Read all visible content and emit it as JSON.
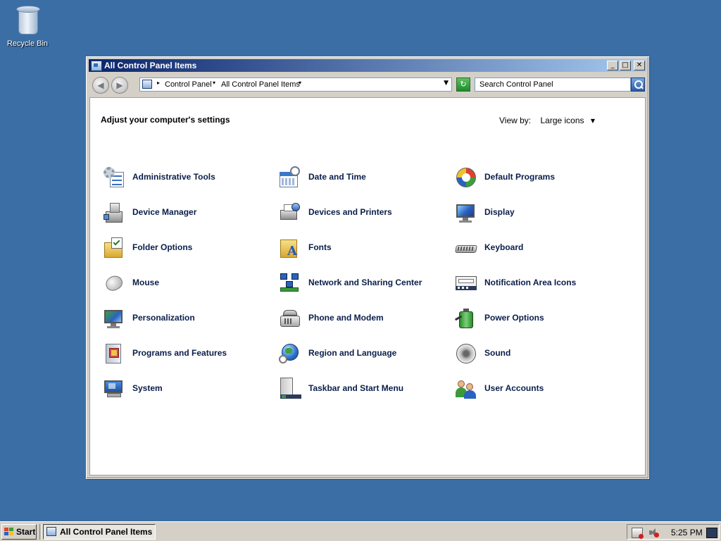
{
  "desktop": {
    "recycle_bin_label": "Recycle Bin"
  },
  "window": {
    "title": "All Control Panel Items",
    "controls": {
      "minimize": "_",
      "maximize": "□",
      "close": "✕"
    }
  },
  "address": {
    "breadcrumb": [
      "Control Panel",
      "All Control Panel Items"
    ],
    "search_placeholder": "Search Control Panel"
  },
  "content": {
    "heading": "Adjust your computer's settings",
    "view_by_label": "View by:",
    "view_by_value": "Large icons"
  },
  "items": [
    {
      "label": "Administrative Tools",
      "icon": "administrative-tools-icon"
    },
    {
      "label": "Date and Time",
      "icon": "date-time-icon"
    },
    {
      "label": "Default Programs",
      "icon": "default-programs-icon"
    },
    {
      "label": "Device Manager",
      "icon": "device-manager-icon"
    },
    {
      "label": "Devices and Printers",
      "icon": "devices-printers-icon"
    },
    {
      "label": "Display",
      "icon": "display-icon"
    },
    {
      "label": "Folder Options",
      "icon": "folder-options-icon"
    },
    {
      "label": "Fonts",
      "icon": "fonts-icon"
    },
    {
      "label": "Keyboard",
      "icon": "keyboard-icon"
    },
    {
      "label": "Mouse",
      "icon": "mouse-icon"
    },
    {
      "label": "Network and Sharing Center",
      "icon": "network-icon"
    },
    {
      "label": "Notification Area Icons",
      "icon": "notification-area-icon"
    },
    {
      "label": "Personalization",
      "icon": "personalization-icon"
    },
    {
      "label": "Phone and Modem",
      "icon": "phone-modem-icon"
    },
    {
      "label": "Power Options",
      "icon": "power-options-icon"
    },
    {
      "label": "Programs and Features",
      "icon": "programs-features-icon"
    },
    {
      "label": "Region and Language",
      "icon": "region-language-icon"
    },
    {
      "label": "Sound",
      "icon": "sound-icon"
    },
    {
      "label": "System",
      "icon": "system-icon"
    },
    {
      "label": "Taskbar and Start Menu",
      "icon": "taskbar-start-menu-icon"
    },
    {
      "label": "User Accounts",
      "icon": "user-accounts-icon"
    }
  ],
  "taskbar": {
    "start_label": "Start",
    "task_label": "All Control Panel Items",
    "clock": "5:25 PM"
  },
  "colors": {
    "desktop": "#3a6ea5",
    "titlebar_start": "#0a246a",
    "titlebar_end": "#a6caf0",
    "item_text": "#0a1e4a"
  }
}
